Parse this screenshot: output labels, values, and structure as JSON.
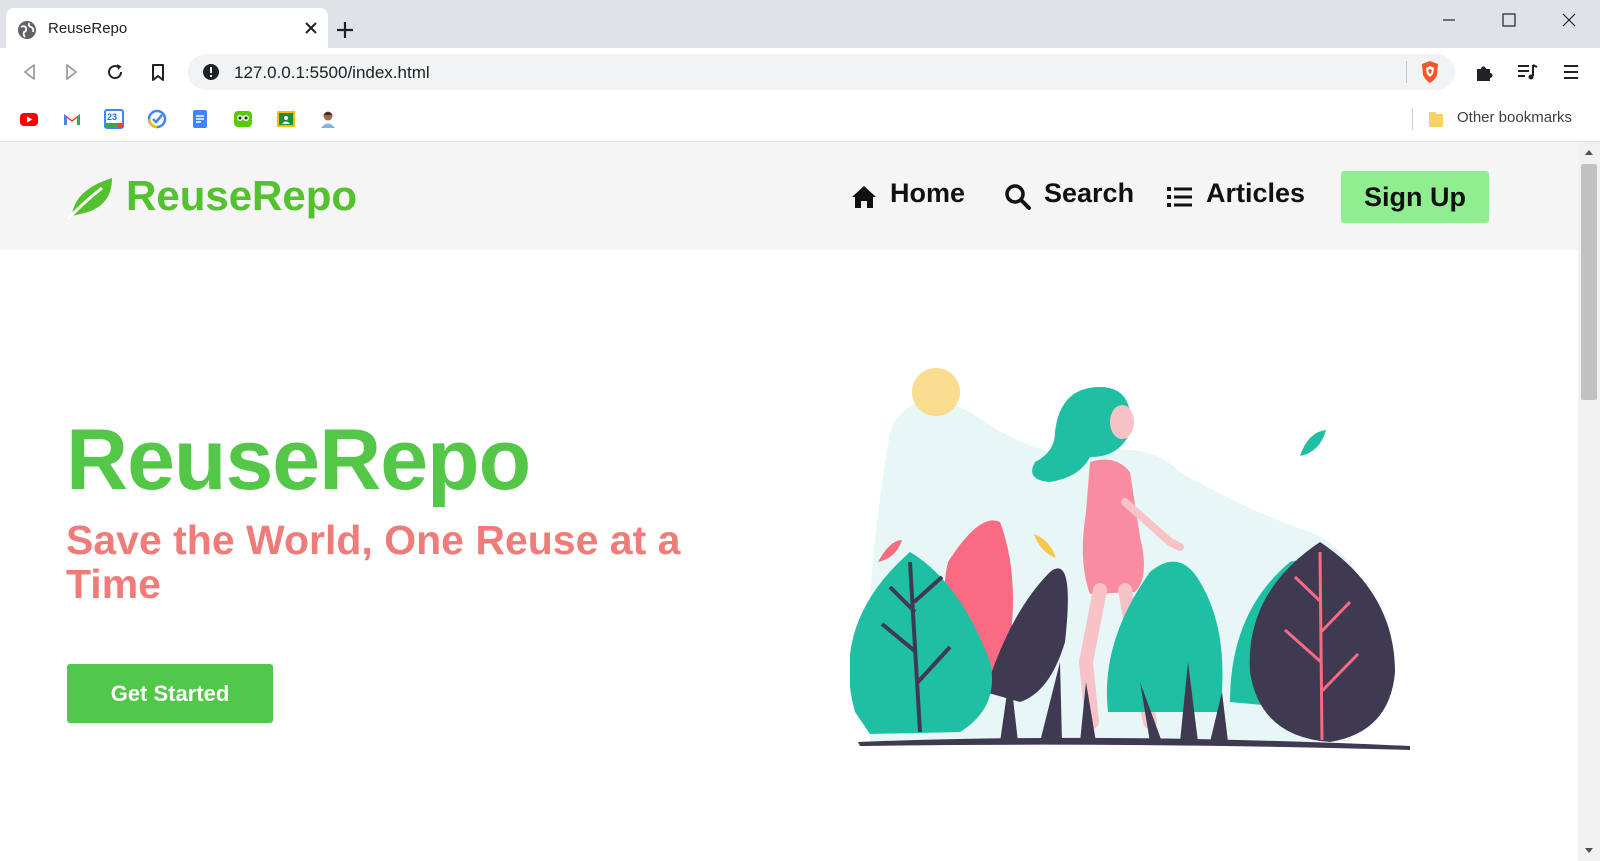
{
  "browser": {
    "tab": {
      "title": "ReuseRepo",
      "favicon": "globe-icon"
    },
    "url": "127.0.0.1:5500/index.html",
    "bookmarks": [
      "youtube-icon",
      "gmail-icon",
      "calendar-icon",
      "tasks-icon",
      "docs-icon",
      "duolingo-icon",
      "classroom-icon",
      "avatar-icon"
    ],
    "calendar_day": "23",
    "other_bookmarks_label": "Other bookmarks"
  },
  "site": {
    "brand": "ReuseRepo",
    "nav": [
      {
        "label": "Home",
        "icon": "home-icon"
      },
      {
        "label": "Search",
        "icon": "search-icon"
      },
      {
        "label": "Articles",
        "icon": "list-icon"
      }
    ],
    "signup_label": "Sign Up",
    "hero": {
      "title": "ReuseRepo",
      "subtitle": "Save the World, One Reuse at a Time",
      "cta_label": "Get Started"
    },
    "colors": {
      "brand_green": "#54c12e",
      "hero_green": "#54c749",
      "subtitle_pink": "#f07c79",
      "signup_bg": "#90ee90",
      "cta_bg": "#52c84b"
    }
  }
}
